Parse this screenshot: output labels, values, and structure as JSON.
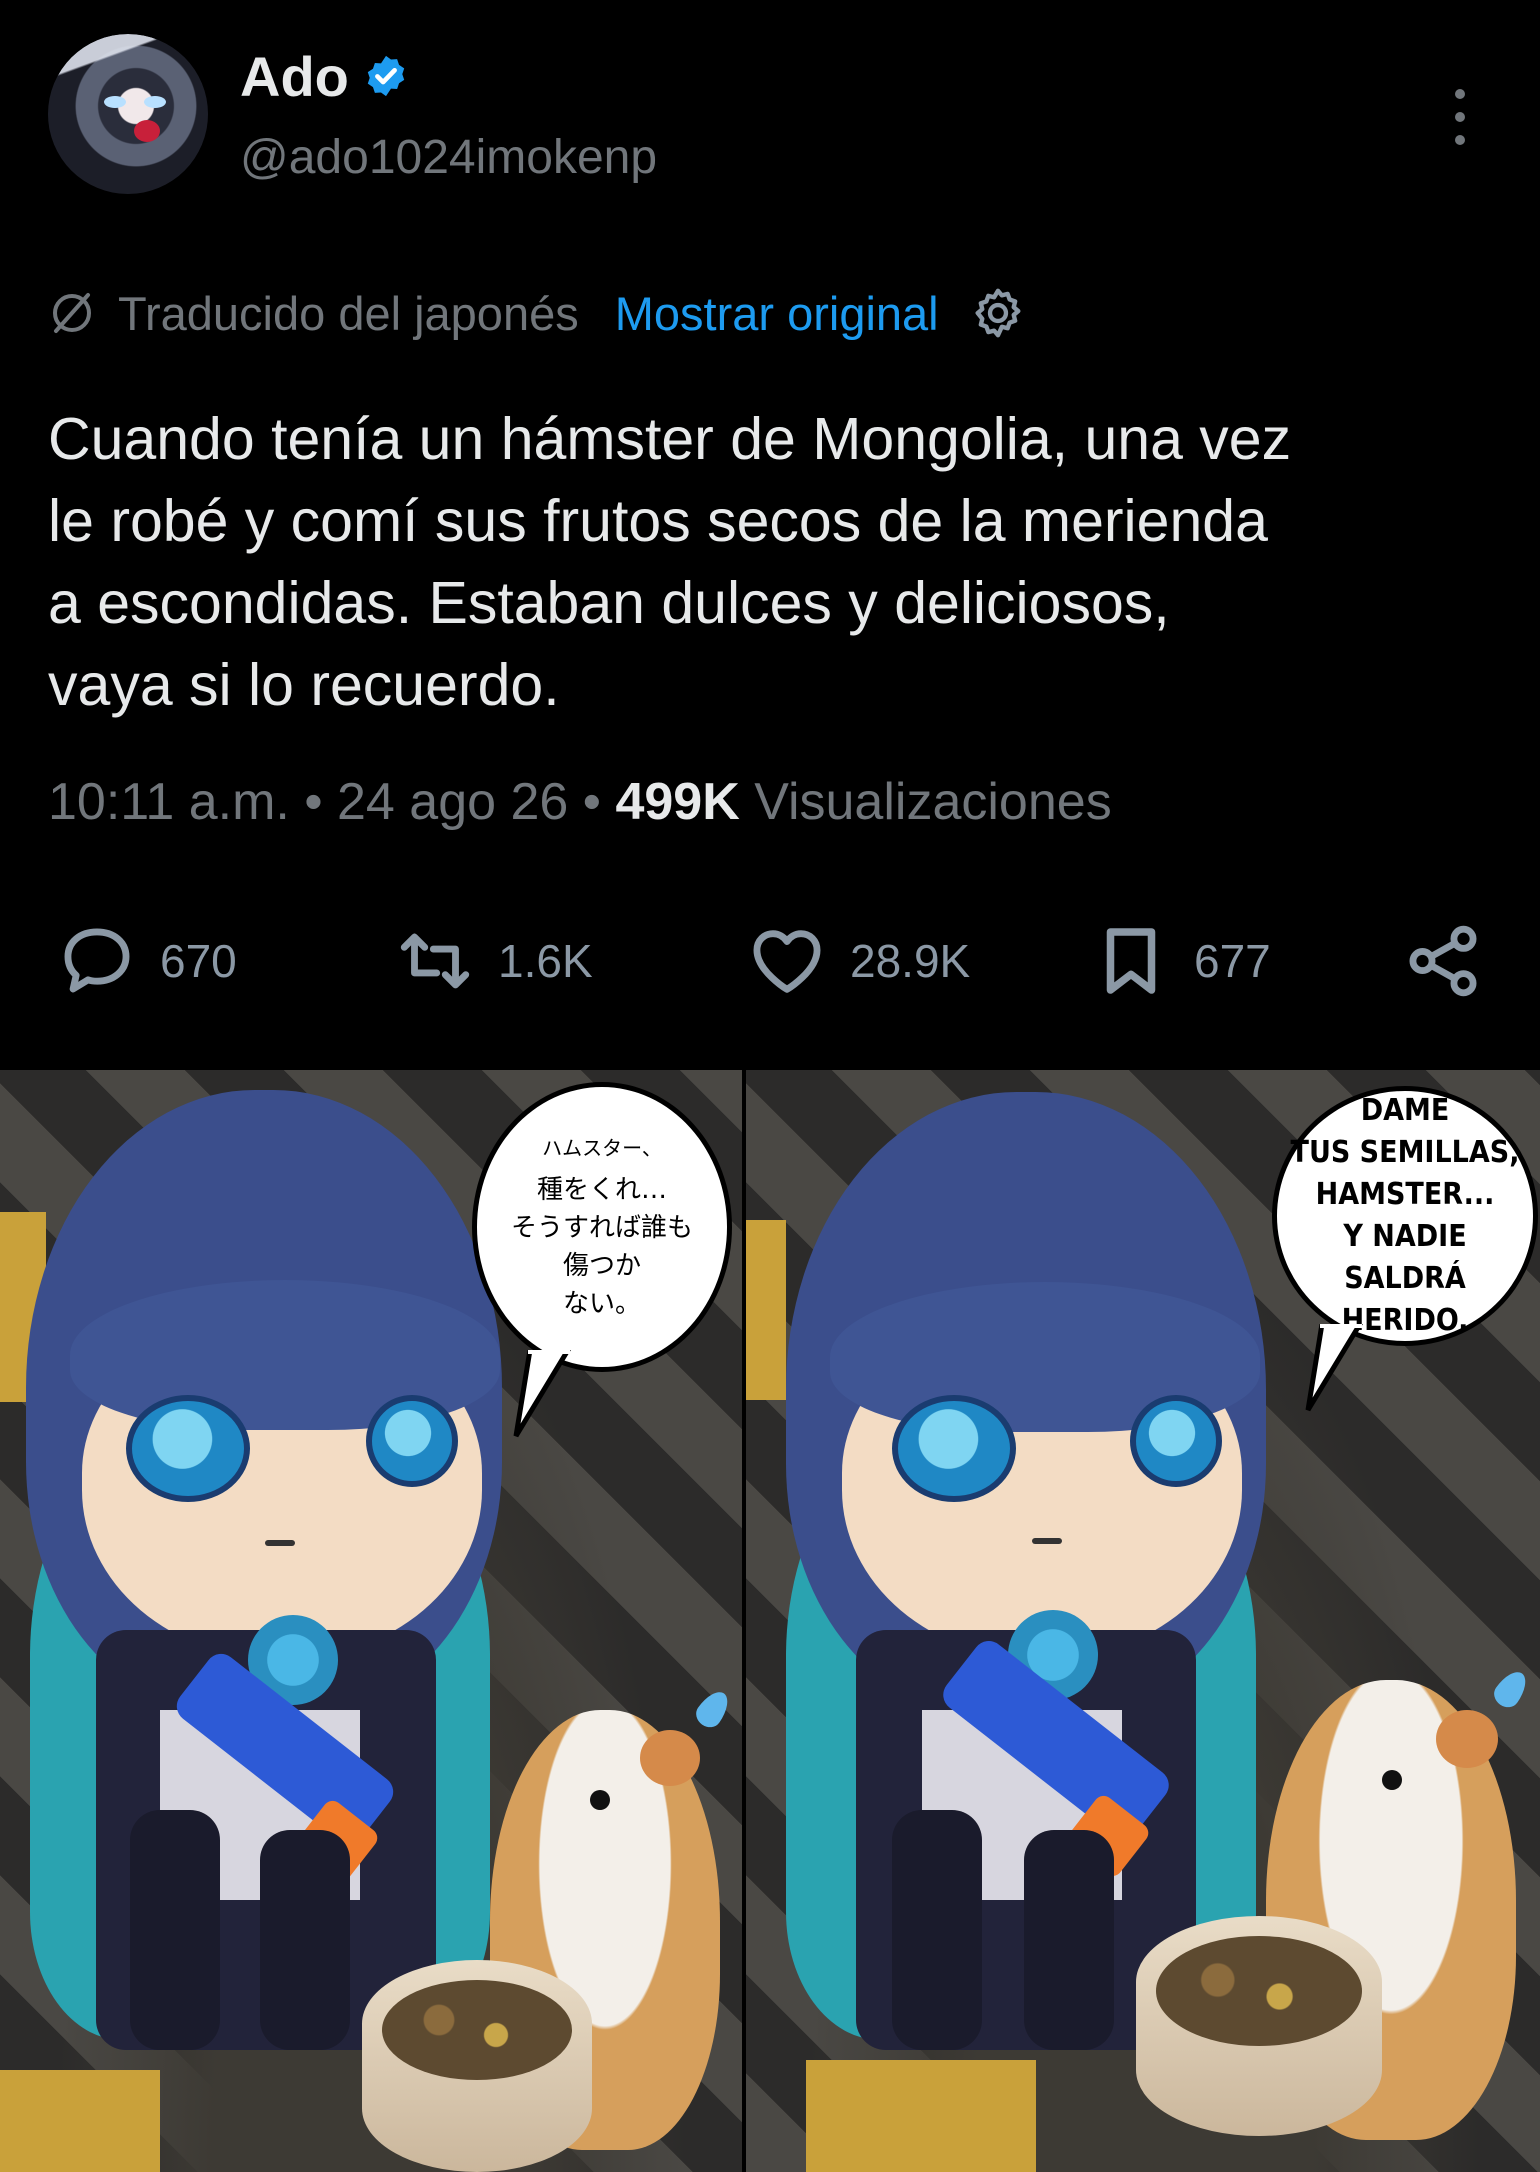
{
  "header": {
    "name": "Ado",
    "handle": "@ado1024imokenp"
  },
  "translation": {
    "label": "Traducido del japonés",
    "show_original": "Mostrar original"
  },
  "tweet": {
    "lines": [
      "Cuando tenía un hámster de Mongolia, una vez",
      "le robé y comí sus frutos secos de la merienda",
      "a escondidas. Estaban dulces y deliciosos,",
      "vaya si lo recuerdo."
    ]
  },
  "meta": {
    "time": "10:11 a.m.",
    "date": "24 ago 26",
    "views_count": "499K",
    "views_label": "Visualizaciones",
    "separator": "•"
  },
  "actions": {
    "replies": "670",
    "reposts": "1.6K",
    "likes": "28.9K",
    "bookmarks": "677"
  },
  "images": {
    "left_bubble": {
      "small": "ハムスター、",
      "lines": [
        "種をくれ…",
        "そうすれば誰も",
        "傷つか",
        "ない。"
      ]
    },
    "right_bubble": {
      "lines": [
        "DAME",
        "TUS SEMILLAS,",
        "HAMSTER...",
        "Y NADIE",
        "SALDRÁ HERIDO."
      ]
    }
  },
  "colors": {
    "background": "#000000",
    "text": "#e7e9ea",
    "muted": "#71767b",
    "link": "#1d9bf0",
    "verified": "#1d9bf0"
  },
  "icons": [
    "verified-badge-icon",
    "more-options-icon",
    "translate-icon",
    "gear-icon",
    "reply-icon",
    "repost-icon",
    "like-icon",
    "bookmark-icon",
    "share-icon"
  ]
}
